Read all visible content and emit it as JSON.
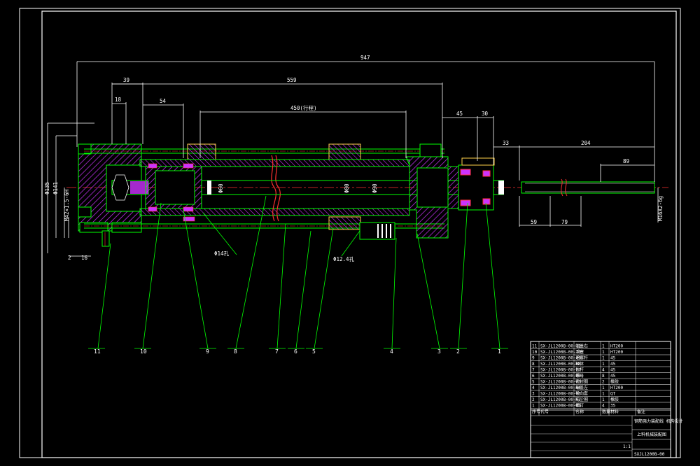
{
  "colors": {
    "background": "#000000",
    "frame": "#ffffff",
    "outline": "#00ff00",
    "hatch": "#cc33ff",
    "centerline": "#ff3030",
    "dimension": "#ffffff",
    "thread": "#ff3030",
    "yellow": "#ffd24a",
    "cyan": "#00e0e0"
  },
  "dimensions": {
    "overall_length": "947",
    "length_559": "559",
    "stroke": "450(行程)",
    "d39": "39",
    "d18": "18",
    "d54": "54",
    "d45": "45",
    "d30": "30",
    "d33": "33",
    "d204": "204",
    "d89": "89",
    "d59": "59",
    "d79": "79",
    "d2": "2",
    "d16": "16",
    "phi135": "Φ135",
    "phi141": "Φ141",
    "m_thread": "M42×1.5-6H",
    "phi4": "Φ14孔",
    "phi12": "Φ12.4孔",
    "rod_thread": "M16X2-6g",
    "phi60": "Φ60",
    "phi80": "Φ80",
    "phi90": "Φ90"
  },
  "balloons": [
    "11",
    "10",
    "9",
    "8",
    "7",
    "6",
    "5",
    "4",
    "3",
    "2",
    "1"
  ],
  "title_block": {
    "parts": [
      {
        "no": "11",
        "code": "SX-JL1200B-00-11",
        "name": "端盖右",
        "qty": "1",
        "material": "HT200"
      },
      {
        "no": "10",
        "code": "SX-JL1200B-00-10",
        "name": "活塞",
        "qty": "1",
        "material": "HT200"
      },
      {
        "no": "9",
        "code": "SX-JL1200B-00-09",
        "name": "活塞杆",
        "qty": "1",
        "material": "45"
      },
      {
        "no": "8",
        "code": "SX-JL1200B-00-08",
        "name": "缸体",
        "qty": "1",
        "material": "45"
      },
      {
        "no": "7",
        "code": "SX-JL1200B-00-07",
        "name": "拉杆",
        "qty": "4",
        "material": "45"
      },
      {
        "no": "6",
        "code": "SX-JL1200B-00-06",
        "name": "螺母",
        "qty": "8",
        "material": "45"
      },
      {
        "no": "5",
        "code": "SX-JL1200B-00-05",
        "name": "密封圈",
        "qty": "2",
        "material": "橡胶"
      },
      {
        "no": "4",
        "code": "SX-JL1200B-00-04",
        "name": "端盖左",
        "qty": "1",
        "material": "HT200"
      },
      {
        "no": "3",
        "code": "SX-JL1200B-00-03",
        "name": "导向套",
        "qty": "1",
        "material": "QT"
      },
      {
        "no": "2",
        "code": "SX-JL1200B-00-02",
        "name": "防尘圈",
        "qty": "1",
        "material": "橡胶"
      },
      {
        "no": "1",
        "code": "SX-JL1200B-00-01",
        "name": "螺钉",
        "qty": "4",
        "material": "35"
      }
    ],
    "header_row": [
      "序号",
      "代号",
      "名称",
      "数量",
      "材料",
      "备注"
    ],
    "project": "钢筋强力装配线\n机构设计",
    "drawing_name": "上料机械装配图",
    "scale": "1:1",
    "drawing_code": "SXJL1200B-00"
  }
}
